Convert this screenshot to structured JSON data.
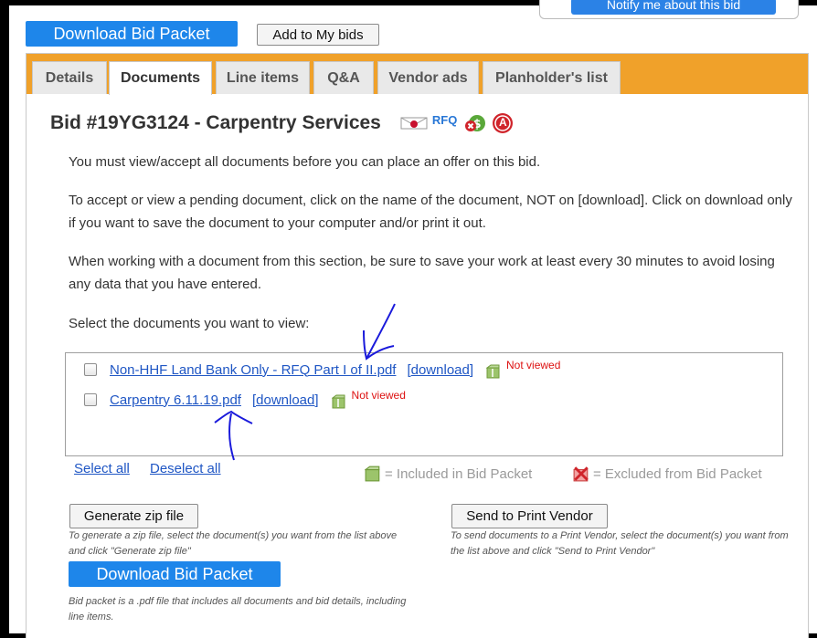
{
  "top": {
    "notify_label": "Notify me about this bid",
    "download_label": "Download Bid Packet",
    "add_label": "Add to My bids"
  },
  "tabs": [
    {
      "label": "Details",
      "active": false
    },
    {
      "label": "Documents",
      "active": true
    },
    {
      "label": "Line items",
      "active": false
    },
    {
      "label": "Q&A",
      "active": false
    },
    {
      "label": "Vendor ads",
      "active": false
    },
    {
      "label": "Planholder's list",
      "active": false
    }
  ],
  "bid": {
    "title": "Bid #19YG3124 - Carpentry Services",
    "rfq_label": "RFQ",
    "acrobat_letter": "A"
  },
  "instructions": {
    "p1": "You must view/accept all documents before you can place an offer on this bid.",
    "p2": "To accept or view a pending document, click on the name of the document, NOT on [download]. Click on download only if you want to save the document to your computer and/or print it out.",
    "p3": "When working with a document from this section, be sure to save your work at least every 30 minutes to avoid losing any data that you have entered.",
    "p4": "Select the documents you want to view:"
  },
  "documents": [
    {
      "name": "Non-HHF Land Bank Only - RFQ Part I of II.pdf",
      "download": "[download]",
      "status": "Not viewed"
    },
    {
      "name": "Carpentry 6.11.19.pdf",
      "download": "[download]",
      "status": "Not viewed"
    }
  ],
  "selection": {
    "select_all": "Select all",
    "deselect_all": "Deselect all"
  },
  "legend": {
    "included": "= Included in Bid Packet",
    "excluded": "= Excluded from Bid Packet"
  },
  "actions": {
    "zip_label": "Generate zip file",
    "zip_note": "To generate a zip file, select the document(s) you want from the list above and click \"Generate zip file\"",
    "print_label": "Send to Print Vendor",
    "print_note": "To send documents to a Print Vendor, select the document(s) you want from the list above and click \"Send to Print Vendor\"",
    "download_label": "Download Bid Packet",
    "download_note": "Bid packet is a .pdf file that includes all documents and bid details, including line items."
  },
  "colors": {
    "tab_bar": "#f0a12a",
    "primary_button": "#1e86ea",
    "link": "#1f56c4",
    "not_viewed": "#dd1111",
    "annotation": "#1a1adb"
  }
}
